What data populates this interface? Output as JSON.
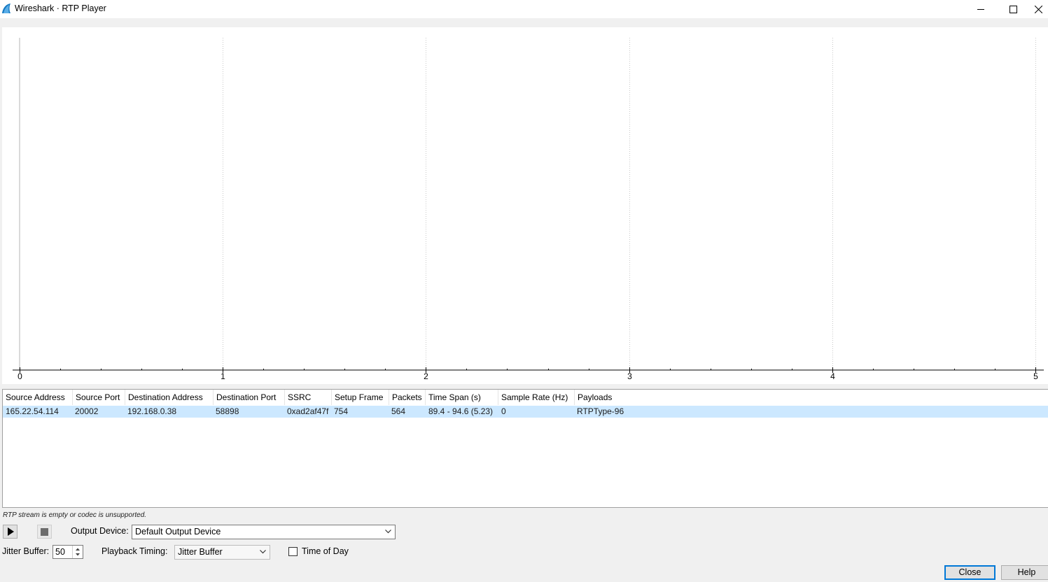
{
  "window": {
    "title": "Wireshark · RTP Player"
  },
  "plot": {
    "x_ticks": [
      "0",
      "1",
      "2",
      "3",
      "4",
      "5"
    ]
  },
  "table": {
    "columns": [
      "Source Address",
      "Source Port",
      "Destination Address",
      "Destination Port",
      "SSRC",
      "Setup Frame",
      "Packets",
      "Time Span (s)",
      "Sample Rate (Hz)",
      "Payloads"
    ],
    "rows": [
      [
        "165.22.54.114",
        "20002",
        "192.168.0.38",
        "58898",
        "0xad2af47f",
        "754",
        "564",
        "89.4 - 94.6 (5.23)",
        "0",
        "RTPType-96"
      ]
    ]
  },
  "status_text": "RTP stream is empty or codec is unsupported.",
  "controls": {
    "output_device_label": "Output Device:",
    "output_device_value": "Default Output Device",
    "jitter_buffer_label": "Jitter Buffer:",
    "jitter_buffer_value": "50",
    "playback_timing_label": "Playback Timing:",
    "playback_timing_value": "Jitter Buffer",
    "time_of_day_label": "Time of Day",
    "time_of_day_checked": false
  },
  "buttons": {
    "close": "Close",
    "help": "Help"
  },
  "colors": {
    "selection": "#cce8ff",
    "default_button_border": "#0078d7"
  }
}
